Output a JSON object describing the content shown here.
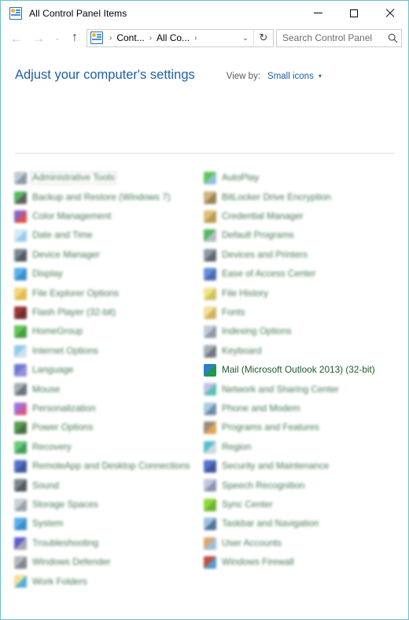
{
  "window": {
    "title": "All Control Panel Items",
    "title_icon": "control-panel-icon",
    "border_color": "#6fc0c8",
    "caption": {
      "minimize": "—",
      "maximize": "□",
      "close": "✕"
    }
  },
  "navbar": {
    "back": "←",
    "forward": "→",
    "recent": "⌄",
    "up": "↑",
    "address_icon": "control-panel-icon",
    "breadcrumbs": [
      "Cont...",
      "All Co..."
    ],
    "separator": "›",
    "dropdown": "⌄",
    "refresh": "↻",
    "search": {
      "placeholder": "Search Control Panel",
      "value": "",
      "icon": "search-icon"
    }
  },
  "header": {
    "page_title": "Adjust your computer's settings",
    "view_by_label": "View by:",
    "view_by_value": "Small icons",
    "view_by_caret": "▾",
    "accent_color": "#1f5fa8"
  },
  "items": {
    "focused_item": "Mail (Microsoft Outlook 2013) (32-bit)",
    "selected_item": "Administrative Tools",
    "label_color": "#1b5c2e",
    "left_column": [
      {
        "label": "Administrative Tools",
        "icon": "administrative-tools-icon",
        "color1": "#b9c4cf",
        "color2": "#7d8b99",
        "sharp": false,
        "selected": true
      },
      {
        "label": "Backup and Restore (Windows 7)",
        "icon": "backup-restore-icon",
        "color1": "#3fae4b",
        "color2": "#4a4a4a",
        "sharp": false,
        "selected": false
      },
      {
        "label": "Color Management",
        "icon": "color-management-icon",
        "color1": "#7a4fbf",
        "color2": "#d83a3a",
        "sharp": false,
        "selected": false
      },
      {
        "label": "Date and Time",
        "icon": "date-time-icon",
        "color1": "#cfe6f7",
        "color2": "#8fc6ea",
        "sharp": false,
        "selected": false
      },
      {
        "label": "Device Manager",
        "icon": "device-manager-icon",
        "color1": "#6b7782",
        "color2": "#3c454d",
        "sharp": false,
        "selected": false
      },
      {
        "label": "Display",
        "icon": "display-icon",
        "color1": "#41a6e8",
        "color2": "#1f7fc4",
        "sharp": false,
        "selected": false
      },
      {
        "label": "File Explorer Options",
        "icon": "file-explorer-options-icon",
        "color1": "#f2cf6a",
        "color2": "#e0b23c",
        "sharp": false,
        "selected": false
      },
      {
        "label": "Flash Player (32-bit)",
        "icon": "flash-player-icon",
        "color1": "#8e1b1b",
        "color2": "#5e0f0f",
        "sharp": false,
        "selected": false
      },
      {
        "label": "HomeGroup",
        "icon": "homegroup-icon",
        "color1": "#4cbf3f",
        "color2": "#2f8f2a",
        "sharp": false,
        "selected": false
      },
      {
        "label": "Internet Options",
        "icon": "internet-options-icon",
        "color1": "#7fc4e8",
        "color2": "#c9dde8",
        "sharp": false,
        "selected": false
      },
      {
        "label": "Language",
        "icon": "language-icon",
        "color1": "#5566cc",
        "color2": "#8a7fd6",
        "sharp": false,
        "selected": false
      },
      {
        "label": "Mouse",
        "icon": "mouse-icon",
        "color1": "#9aa3ab",
        "color2": "#55606a",
        "sharp": false,
        "selected": false
      },
      {
        "label": "Personalization",
        "icon": "personalization-icon",
        "color1": "#8e5fd6",
        "color2": "#d0447f",
        "sharp": false,
        "selected": false
      },
      {
        "label": "Power Options",
        "icon": "power-options-icon",
        "color1": "#3f8f3a",
        "color2": "#2c5f2a",
        "sharp": false,
        "selected": false
      },
      {
        "label": "Recovery",
        "icon": "recovery-icon",
        "color1": "#53c46a",
        "color2": "#2f8f46",
        "sharp": false,
        "selected": false
      },
      {
        "label": "RemoteApp and Desktop Connections",
        "icon": "remoteapp-icon",
        "color1": "#3b5fc4",
        "color2": "#26408a",
        "sharp": false,
        "selected": false
      },
      {
        "label": "Sound",
        "icon": "sound-icon",
        "color1": "#6b7782",
        "color2": "#3c454d",
        "sharp": false,
        "selected": false
      },
      {
        "label": "Storage Spaces",
        "icon": "storage-spaces-icon",
        "color1": "#c5cbd1",
        "color2": "#8d959d",
        "sharp": false,
        "selected": false
      },
      {
        "label": "System",
        "icon": "system-icon",
        "color1": "#41a6e8",
        "color2": "#1f7fc4",
        "sharp": false,
        "selected": false
      },
      {
        "label": "Troubleshooting",
        "icon": "troubleshooting-icon",
        "color1": "#4b48c9",
        "color2": "#9a9aa8",
        "sharp": false,
        "selected": false
      },
      {
        "label": "Windows Defender",
        "icon": "windows-defender-icon",
        "color1": "#a9aeb3",
        "color2": "#6f767c",
        "sharp": false,
        "selected": false
      },
      {
        "label": "Work Folders",
        "icon": "work-folders-icon",
        "color1": "#f2d98a",
        "color2": "#3fa3d8",
        "sharp": false,
        "selected": false
      }
    ],
    "right_column": [
      {
        "label": "AutoPlay",
        "icon": "autoplay-icon",
        "color1": "#4cbf3f",
        "color2": "#7fb8d8",
        "sharp": false,
        "selected": false
      },
      {
        "label": "BitLocker Drive Encryption",
        "icon": "bitlocker-icon",
        "color1": "#c9a86a",
        "color2": "#8a7340",
        "sharp": false,
        "selected": false
      },
      {
        "label": "Credential Manager",
        "icon": "credential-manager-icon",
        "color1": "#d9b56a",
        "color2": "#b08f3c",
        "sharp": false,
        "selected": false
      },
      {
        "label": "Default Programs",
        "icon": "default-programs-icon",
        "color1": "#3fae4b",
        "color2": "#a9b3bb",
        "sharp": false,
        "selected": false
      },
      {
        "label": "Devices and Printers",
        "icon": "devices-printers-icon",
        "color1": "#7d8b99",
        "color2": "#4a545c",
        "sharp": false,
        "selected": false
      },
      {
        "label": "Ease of Access Center",
        "icon": "ease-of-access-icon",
        "color1": "#4f7fd8",
        "color2": "#2f56a8",
        "sharp": false,
        "selected": false
      },
      {
        "label": "File History",
        "icon": "file-history-icon",
        "color1": "#f0e07a",
        "color2": "#c9b84a",
        "sharp": false,
        "selected": false
      },
      {
        "label": "Fonts",
        "icon": "fonts-icon",
        "color1": "#f2d98a",
        "color2": "#c9a84a",
        "sharp": false,
        "selected": false
      },
      {
        "label": "Indexing Options",
        "icon": "indexing-options-icon",
        "color1": "#b9c4cf",
        "color2": "#7d8b99",
        "sharp": false,
        "selected": false
      },
      {
        "label": "Keyboard",
        "icon": "keyboard-icon",
        "color1": "#9aa3ab",
        "color2": "#5b646c",
        "sharp": false,
        "selected": false
      },
      {
        "label": "Mail (Microsoft Outlook 2013) (32-bit)",
        "icon": "mail-outlook-icon",
        "color1": "#2f7fc4",
        "color2": "#1f9a4f",
        "sharp": true,
        "selected": false
      },
      {
        "label": "Network and Sharing Center",
        "icon": "network-sharing-icon",
        "color1": "#b9b9e0",
        "color2": "#3fb8a8",
        "sharp": false,
        "selected": false
      },
      {
        "label": "Phone and Modem",
        "icon": "phone-modem-icon",
        "color1": "#9ec4e0",
        "color2": "#5b7d99",
        "sharp": false,
        "selected": false
      },
      {
        "label": "Programs and Features",
        "icon": "programs-features-icon",
        "color1": "#8a7a6a",
        "color2": "#d89a3c",
        "sharp": false,
        "selected": false
      },
      {
        "label": "Region",
        "icon": "region-icon",
        "color1": "#3fb8c4",
        "color2": "#c9d4db",
        "sharp": false,
        "selected": false
      },
      {
        "label": "Security and Maintenance",
        "icon": "security-maintenance-icon",
        "color1": "#3b5fc4",
        "color2": "#26408a",
        "sharp": false,
        "selected": false
      },
      {
        "label": "Speech Recognition",
        "icon": "speech-recognition-icon",
        "color1": "#b9bfd6",
        "color2": "#7d86a8",
        "sharp": false,
        "selected": false
      },
      {
        "label": "Sync Center",
        "icon": "sync-center-icon",
        "color1": "#7ed321",
        "color2": "#5aa818",
        "sharp": false,
        "selected": false
      },
      {
        "label": "Taskbar and Navigation",
        "icon": "taskbar-navigation-icon",
        "color1": "#8fb8d8",
        "color2": "#3b5f8a",
        "sharp": false,
        "selected": false
      },
      {
        "label": "User Accounts",
        "icon": "user-accounts-icon",
        "color1": "#d89a5c",
        "color2": "#8fb8d8",
        "sharp": false,
        "selected": false
      },
      {
        "label": "Windows Firewall",
        "icon": "windows-firewall-icon",
        "color1": "#b5372b",
        "color2": "#3f8fc4",
        "sharp": false,
        "selected": false
      }
    ]
  }
}
